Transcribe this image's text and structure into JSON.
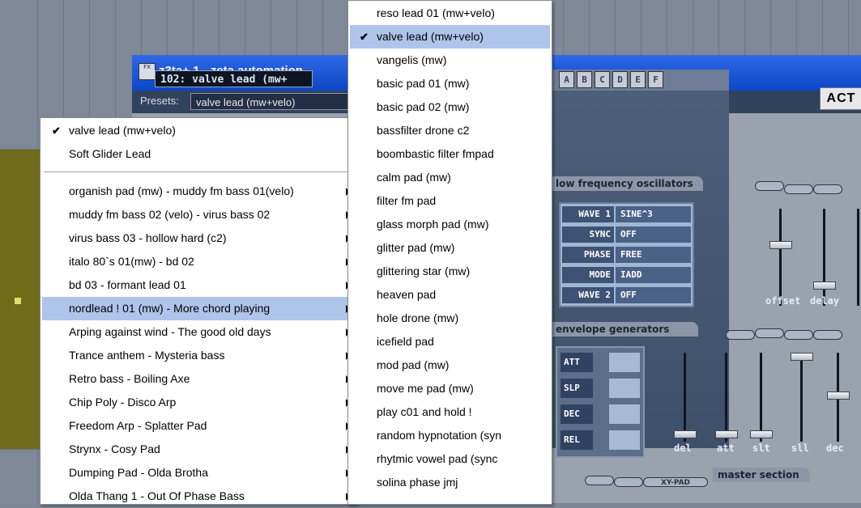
{
  "plugin": {
    "title": "z3ta+ 1 - zeta automation",
    "icon_label": "FX",
    "presets_label": "Presets:",
    "preset_value": "valve lead (mw+velo)",
    "act_button": "ACT"
  },
  "synth": {
    "banks": [
      "A",
      "B",
      "C",
      "D",
      "E",
      "F"
    ],
    "patch_name": "102:  valve lead (mw+",
    "lfo_title": "low frequency oscillators",
    "lfo_rows": [
      {
        "key": "WAVE 1",
        "val": "SINE^3"
      },
      {
        "key": "SYNC",
        "val": "OFF"
      },
      {
        "key": "PHASE",
        "val": "FREE"
      },
      {
        "key": "MODE",
        "val": "IADD"
      },
      {
        "key": "WAVE 2",
        "val": "OFF"
      }
    ],
    "lfo_sliders": [
      "offset",
      "delay"
    ],
    "env_title": "envelope generators",
    "env_rows": [
      "ATT",
      "SLP",
      "DEC",
      "REL"
    ],
    "env_sliders": [
      "del",
      "att",
      "slt",
      "sll",
      "dec"
    ],
    "master_title": "master section",
    "xy_pad_label": "XY-PAD"
  },
  "preset_menu": {
    "items": [
      {
        "label": "valve lead (mw+velo)",
        "checked": true
      },
      {
        "label": "Soft Glider Lead"
      },
      {
        "label": "organish pad (mw) - muddy fm bass 01(velo)",
        "submenu": true
      },
      {
        "label": "muddy fm bass 02 (velo) - virus bass 02",
        "submenu": true
      },
      {
        "label": "virus bass 03 - hollow hard (c2)",
        "submenu": true
      },
      {
        "label": "italo 80`s 01(mw) - bd 02",
        "submenu": true
      },
      {
        "label": "bd 03 - formant lead 01",
        "submenu": true
      },
      {
        "label": "nordlead ! 01 (mw) - More chord playing",
        "submenu": true,
        "selected": true
      },
      {
        "label": "Arping against wind - The good old days",
        "submenu": true
      },
      {
        "label": "Trance anthem - Mysteria bass",
        "submenu": true
      },
      {
        "label": "Retro bass - Boiling Axe",
        "submenu": true
      },
      {
        "label": "Chip Poly - Disco Arp",
        "submenu": true
      },
      {
        "label": "Freedom Arp - Splatter Pad",
        "submenu": true
      },
      {
        "label": "Strynx - Cosy Pad",
        "submenu": true
      },
      {
        "label": "Dumping Pad - Olda Brotha",
        "submenu": true
      },
      {
        "label": "Olda Thang 1 - Out Of Phase Bass",
        "submenu": true
      }
    ]
  },
  "sub_menu": {
    "items": [
      {
        "label": "reso lead 01 (mw+velo)"
      },
      {
        "label": "valve lead (mw+velo)",
        "checked": true,
        "selected": true
      },
      {
        "label": "vangelis (mw)"
      },
      {
        "label": "basic pad 01 (mw)"
      },
      {
        "label": "basic pad 02 (mw)"
      },
      {
        "label": "bassfilter drone c2"
      },
      {
        "label": "boombastic filter fmpad"
      },
      {
        "label": "calm pad (mw)"
      },
      {
        "label": "filter fm pad"
      },
      {
        "label": "glass morph pad (mw)"
      },
      {
        "label": "glitter pad (mw)"
      },
      {
        "label": "glittering star (mw)"
      },
      {
        "label": "heaven pad"
      },
      {
        "label": "hole drone (mw)"
      },
      {
        "label": "icefield pad"
      },
      {
        "label": "mod pad (mw)"
      },
      {
        "label": "move me pad (mw)"
      },
      {
        "label": "play c01 and hold !"
      },
      {
        "label": "random hypnotation (syn"
      },
      {
        "label": "rhytmic vowel pad (sync"
      },
      {
        "label": "solina phase jmj"
      }
    ]
  },
  "colors": {
    "titlebar": "#1e58d8",
    "menu_highlight": "#aec4ea",
    "track_olive": "#6f6b1a"
  }
}
